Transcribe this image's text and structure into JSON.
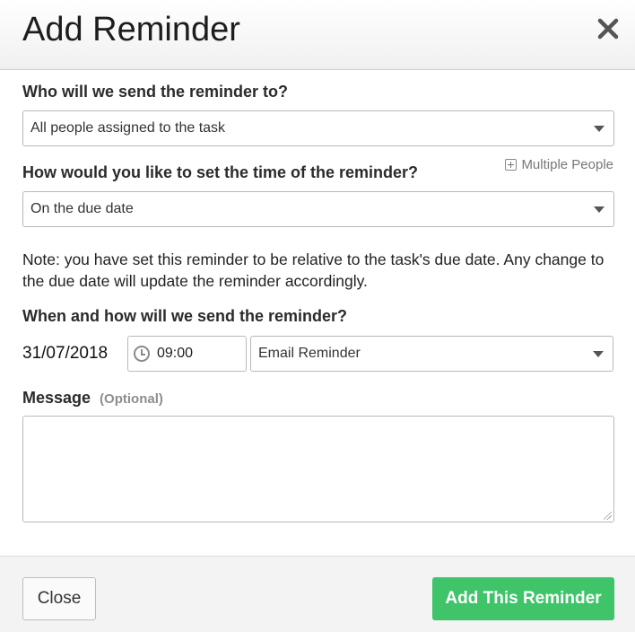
{
  "dialog": {
    "title": "Add Reminder"
  },
  "recipient": {
    "label": "Who will we send the reminder to?",
    "selected": "All people assigned to the task",
    "multiple_people_link": "Multiple People"
  },
  "timing": {
    "label": "How would you like to set the time of the reminder?",
    "selected": "On the due date",
    "note": "Note: you have set this reminder to be relative to the task's due date. Any change to the due date will update the reminder accordingly."
  },
  "schedule": {
    "label": "When and how will we send the reminder?",
    "date": "31/07/2018",
    "time": "09:00",
    "method": "Email Reminder"
  },
  "message": {
    "label": "Message",
    "optional_hint": "(Optional)",
    "value": ""
  },
  "footer": {
    "close_label": "Close",
    "add_label": "Add This Reminder"
  },
  "colors": {
    "primary_button": "#3fc46a",
    "footer_bg": "#f3f3f3"
  }
}
